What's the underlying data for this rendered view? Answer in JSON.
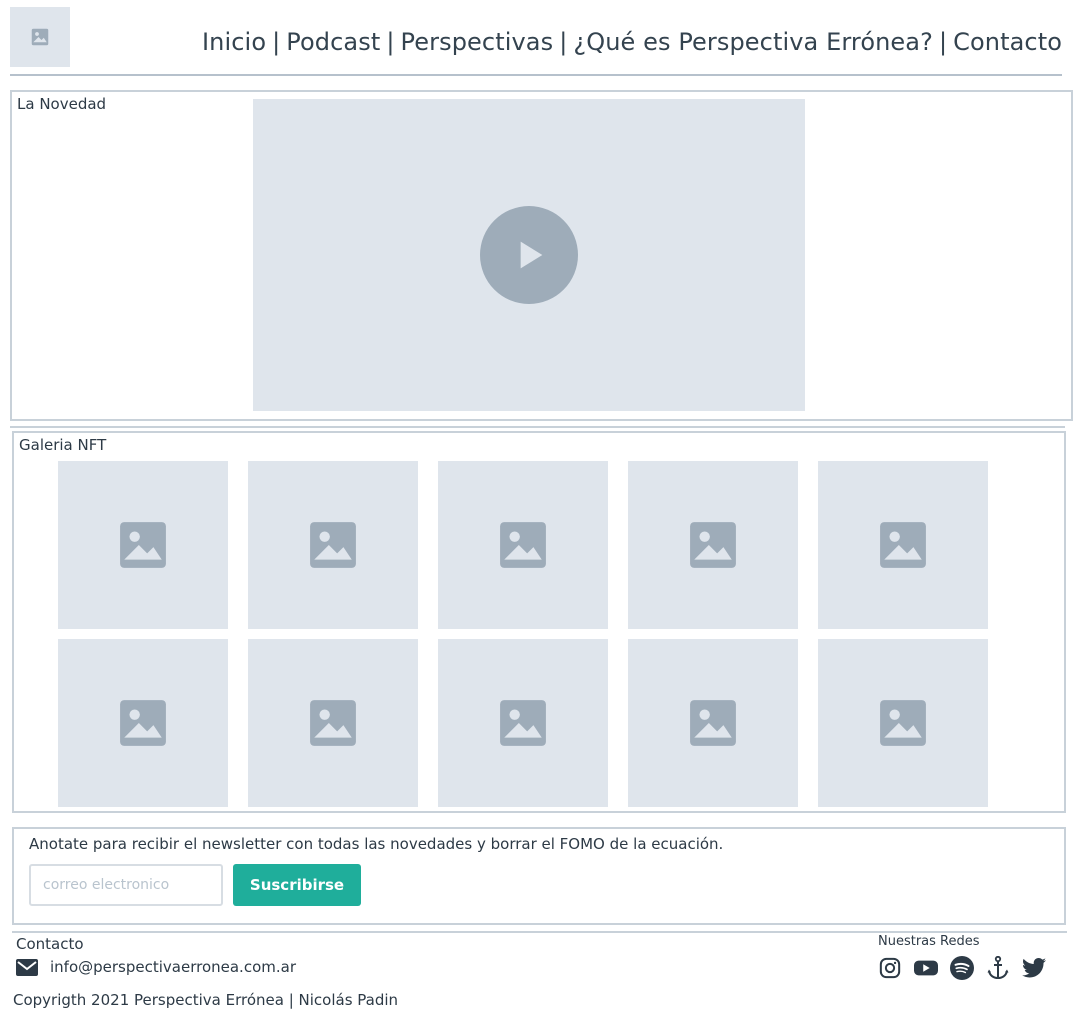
{
  "header": {
    "nav": [
      {
        "label": "Inicio"
      },
      {
        "label": "Podcast"
      },
      {
        "label": "Perspectivas"
      },
      {
        "label": "¿Qué es Perspectiva Errónea?"
      },
      {
        "label": "Contacto"
      }
    ],
    "separator": "|"
  },
  "novedad": {
    "title": "La Novedad"
  },
  "galeria": {
    "title": "Galeria NFT",
    "count": 10
  },
  "newsletter": {
    "text": "Anotate para recibir el newsletter con todas las novedades y borrar el FOMO de la ecuación.",
    "email_placeholder": "correo electronico",
    "subscribe_label": "Suscribirse"
  },
  "footer": {
    "contact_title": "Contacto",
    "email": "info@perspectivaerronea.com.ar",
    "copyright": "Copyrigth 2021 Perspectiva Errónea | Nicolás Padin",
    "redes_title": "Nuestras Redes",
    "socials": [
      "instagram-icon",
      "youtube-icon",
      "spotify-icon",
      "anchor-icon",
      "twitter-icon"
    ]
  },
  "colors": {
    "accent": "#1fae9b",
    "placeholder_bg": "#dfe5ec",
    "placeholder_icon": "#9eacb9",
    "border": "#c8d1d9",
    "text": "#2d3a46"
  }
}
